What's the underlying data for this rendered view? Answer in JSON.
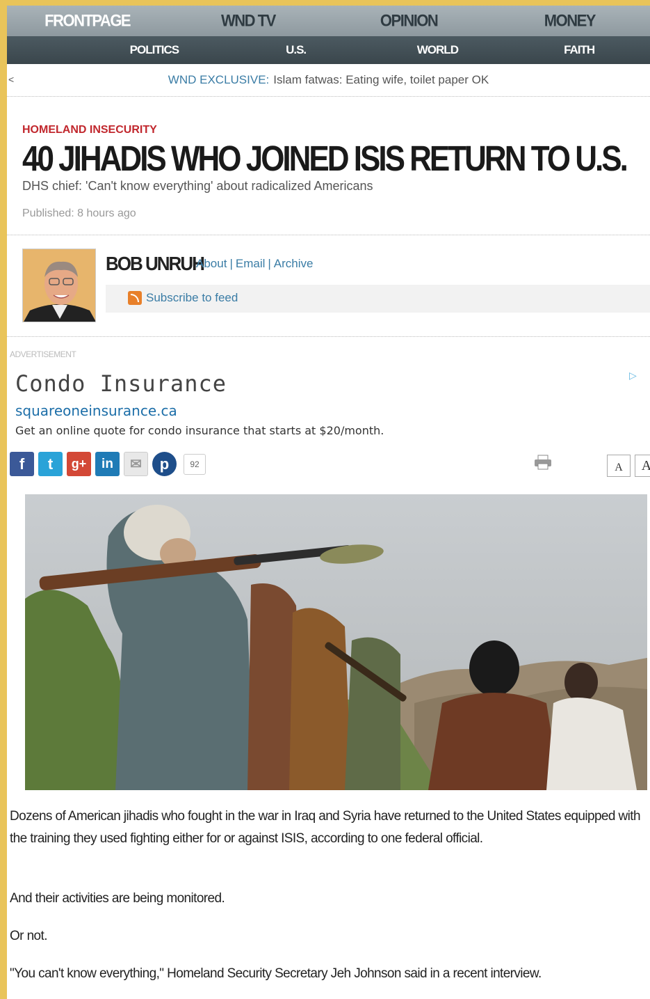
{
  "nav": {
    "top": [
      "FRONTPAGE",
      "WND TV",
      "OPINION",
      "MONEY"
    ],
    "sub": [
      "POLITICS",
      "U.S.",
      "WORLD",
      "FAITH"
    ]
  },
  "ticker": {
    "arrow": "<",
    "label": "WND EXCLUSIVE:",
    "text": "Islam fatwas: Eating wife, toilet paper OK"
  },
  "article": {
    "kicker": "HOMELAND INSECURITY",
    "headline": "40 JIHADIS WHO JOINED ISIS RETURN TO U.S.",
    "subhead": "DHS chief: 'Can't know everything' about radicalized Americans",
    "published": "Published: 8 hours ago",
    "paragraphs": [
      "Dozens of American jihadis who fought in the war in Iraq and Syria have returned to the United States equipped with the training they used fighting either for or against ISIS, according to one federal official.",
      "And their activities are being monitored.",
      "Or not.",
      "\"You can't know everything,\" Homeland Security Secretary Jeh Johnson said in a recent interview."
    ]
  },
  "author": {
    "name": "BOB UNRUH",
    "links": [
      "About",
      "Email",
      "Archive"
    ],
    "separator": "|",
    "feed": "Subscribe to feed"
  },
  "ad": {
    "label": "ADVERTISEMENT",
    "choices": "▷",
    "title": "Condo Insurance",
    "url": "squareoneinsurance.ca",
    "description": "Get an online quote for condo insurance that starts at $20/month."
  },
  "share": {
    "facebook": "f",
    "twitter": "t",
    "gplus": "g+",
    "linkedin": "in",
    "email": "✉",
    "pinterest": "p",
    "count": "92"
  },
  "font_size": {
    "small": "A",
    "large": "A"
  },
  "colors": {
    "kicker": "#c1272d",
    "link": "#3a7ca5",
    "nav_top": "#9aa4a9",
    "nav_sub": "#3f4b51",
    "background": "#e9c45a"
  }
}
